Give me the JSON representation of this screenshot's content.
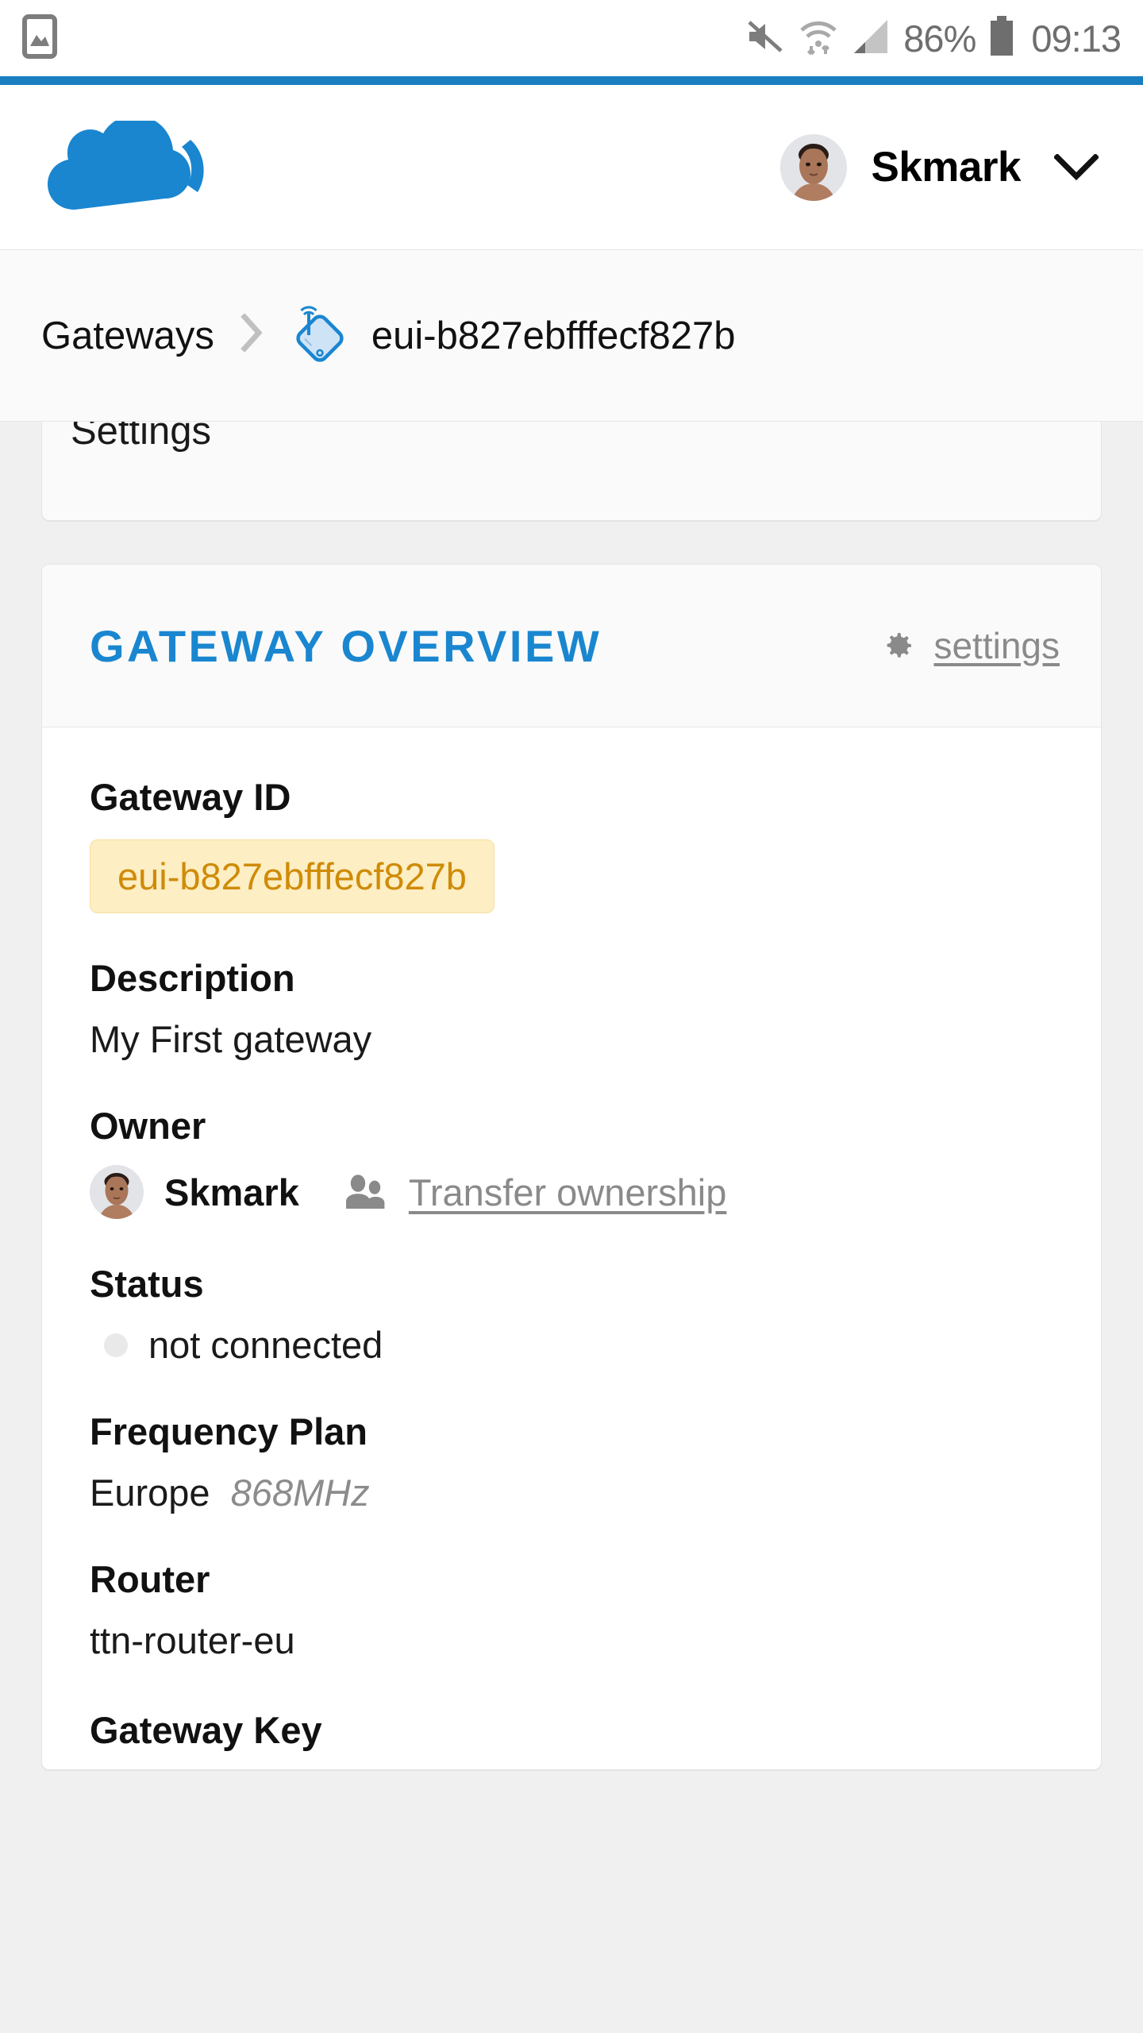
{
  "statusbar": {
    "left_icon": "photo-gallery-icon",
    "mute_icon": "mute-icon",
    "wifi_icon": "wifi-icon",
    "signal_icon": "cell-signal-icon",
    "battery_percent": "86%",
    "battery_icon": "battery-icon",
    "clock": "09:13"
  },
  "header": {
    "logo": "cloud-wifi-logo",
    "username": "Skmark",
    "avatar": "user-avatar",
    "chevron": "chevron-down-icon",
    "accent_color": "#1a7fc1"
  },
  "breadcrumb": {
    "root": "Gateways",
    "separator": "›",
    "icon": "gateway-icon",
    "current": "eui-b827ebfffecf827b"
  },
  "tabcard": {
    "label": "Settings"
  },
  "overview": {
    "title": "GATEWAY OVERVIEW",
    "title_color": "#1a86d0",
    "settings_icon": "gear-icon",
    "settings_label": "settings",
    "fields": {
      "gateway_id_label": "Gateway ID",
      "gateway_id_value": "eui-b827ebfffecf827b",
      "gateway_id_color": "#cf8b08",
      "description_label": "Description",
      "description_value": "My First gateway",
      "owner_label": "Owner",
      "owner_name": "Skmark",
      "owner_avatar": "owner-avatar",
      "transfer_icon": "users-icon",
      "transfer_label": "Transfer ownership",
      "status_label": "Status",
      "status_value": "not connected",
      "status_dot_color": "#e9e9e9",
      "frequency_label": "Frequency Plan",
      "frequency_region": "Europe",
      "frequency_band": "868MHz",
      "router_label": "Router",
      "router_value": "ttn-router-eu",
      "gateway_key_label": "Gateway Key"
    }
  }
}
